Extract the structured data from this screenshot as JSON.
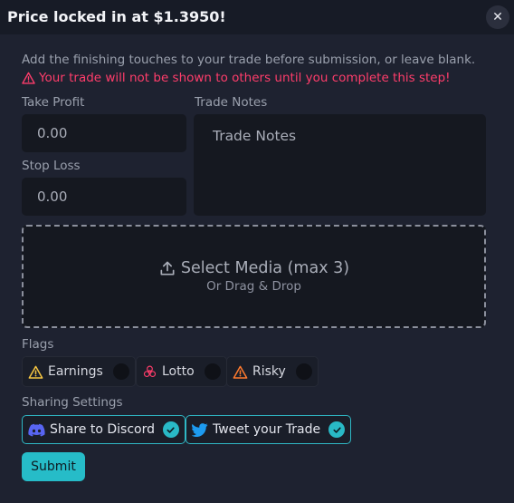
{
  "header": {
    "title": "Price locked in at $1.3950!",
    "close_label": "✕"
  },
  "intro": {
    "info": "Add the finishing touches to your trade before submission, or leave blank.",
    "warning": "Your trade will not be shown to others until you complete this step!"
  },
  "take_profit": {
    "label": "Take Profit",
    "value": "0.00"
  },
  "stop_loss": {
    "label": "Stop Loss",
    "value": "0.00"
  },
  "trade_notes": {
    "label": "Trade Notes",
    "placeholder": "Trade Notes"
  },
  "media": {
    "title": "Select Media (max 3)",
    "subtitle": "Or Drag & Drop"
  },
  "flags": {
    "label": "Flags",
    "items": [
      {
        "label": "Earnings",
        "icon": "warning-icon",
        "color": "#f5c542",
        "enabled": false
      },
      {
        "label": "Lotto",
        "icon": "biohazard-icon",
        "color": "#ff3d6b",
        "enabled": false
      },
      {
        "label": "Risky",
        "icon": "warning-icon",
        "color": "#ff7a2e",
        "enabled": false
      }
    ]
  },
  "sharing": {
    "label": "Sharing Settings",
    "discord": {
      "label": "Share to Discord",
      "icon": "discord-icon",
      "color": "#5865f2",
      "enabled": true
    },
    "twitter": {
      "label": "Tweet your Trade",
      "icon": "twitter-icon",
      "color": "#1d9bf0",
      "enabled": true
    }
  },
  "submit_label": "Submit",
  "colors": {
    "accent": "#26bcc8",
    "warning": "#ff3d6b",
    "background": "#1e2230"
  }
}
